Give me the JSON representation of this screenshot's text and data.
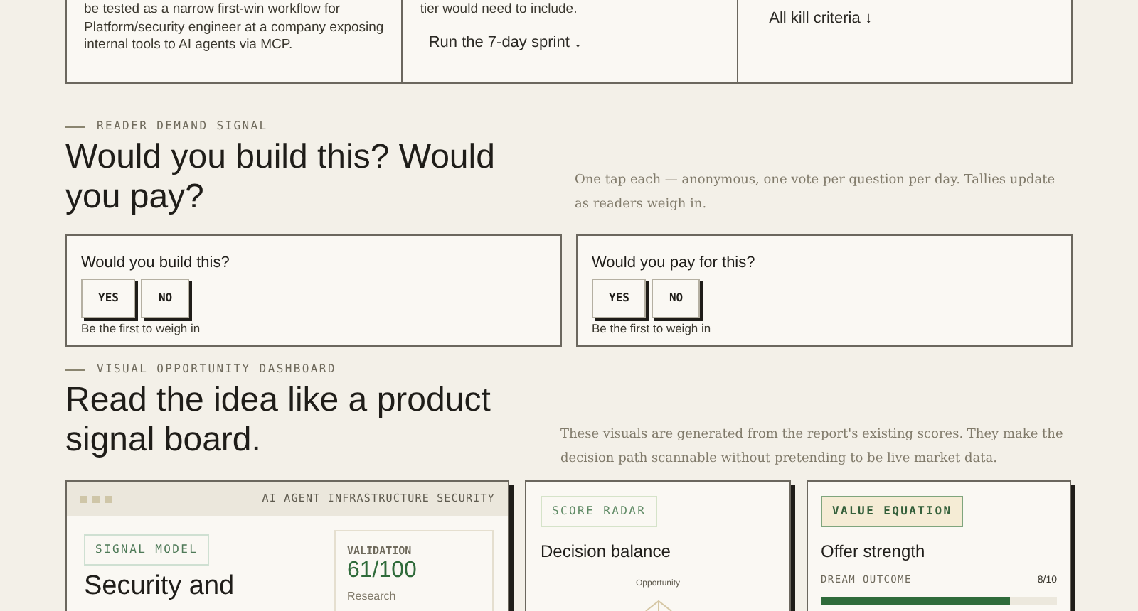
{
  "top_cards": [
    {
      "text": "be tested as a narrow first-win workflow for Platform/security engineer at a company exposing internal tools to AI agents via MCP."
    },
    {
      "text": "tier would need to include.",
      "link": "Run the 7-day sprint ↓"
    },
    {
      "link": "All kill criteria ↓"
    }
  ],
  "demand": {
    "eyebrow": "READER DEMAND SIGNAL",
    "heading": "Would you build this? Would you pay?",
    "note": "One tap each — anonymous, one vote per question per day. Tallies update as readers weigh in.",
    "questions": [
      {
        "question": "Would you build this?",
        "buttons": [
          "YES",
          "NO"
        ],
        "status": "Be the first to weigh in"
      },
      {
        "question": "Would you pay for this?",
        "buttons": [
          "YES",
          "NO"
        ],
        "status": "Be the first to weigh in"
      }
    ]
  },
  "dashboard": {
    "eyebrow": "VISUAL OPPORTUNITY DASHBOARD",
    "heading": "Read the idea like a product signal board.",
    "note": "These visuals are generated from the report's existing scores. They make the decision path scannable without pretending to be live market data.",
    "signal": {
      "window_title": "AI AGENT INFRASTRUCTURE SECURITY",
      "tag": "SIGNAL MODEL",
      "title": "Security and",
      "stat_label": "VALIDATION",
      "stat_value": "61/100",
      "stat_note": "Research"
    },
    "radar": {
      "tag": "SCORE RADAR",
      "title": "Decision balance",
      "axis_label": "Opportunity"
    },
    "value": {
      "tag": "VALUE EQUATION",
      "title": "Offer strength",
      "factors": [
        {
          "label": "DREAM OUTCOME",
          "score": "8/10",
          "level": 0.8
        }
      ]
    }
  }
}
